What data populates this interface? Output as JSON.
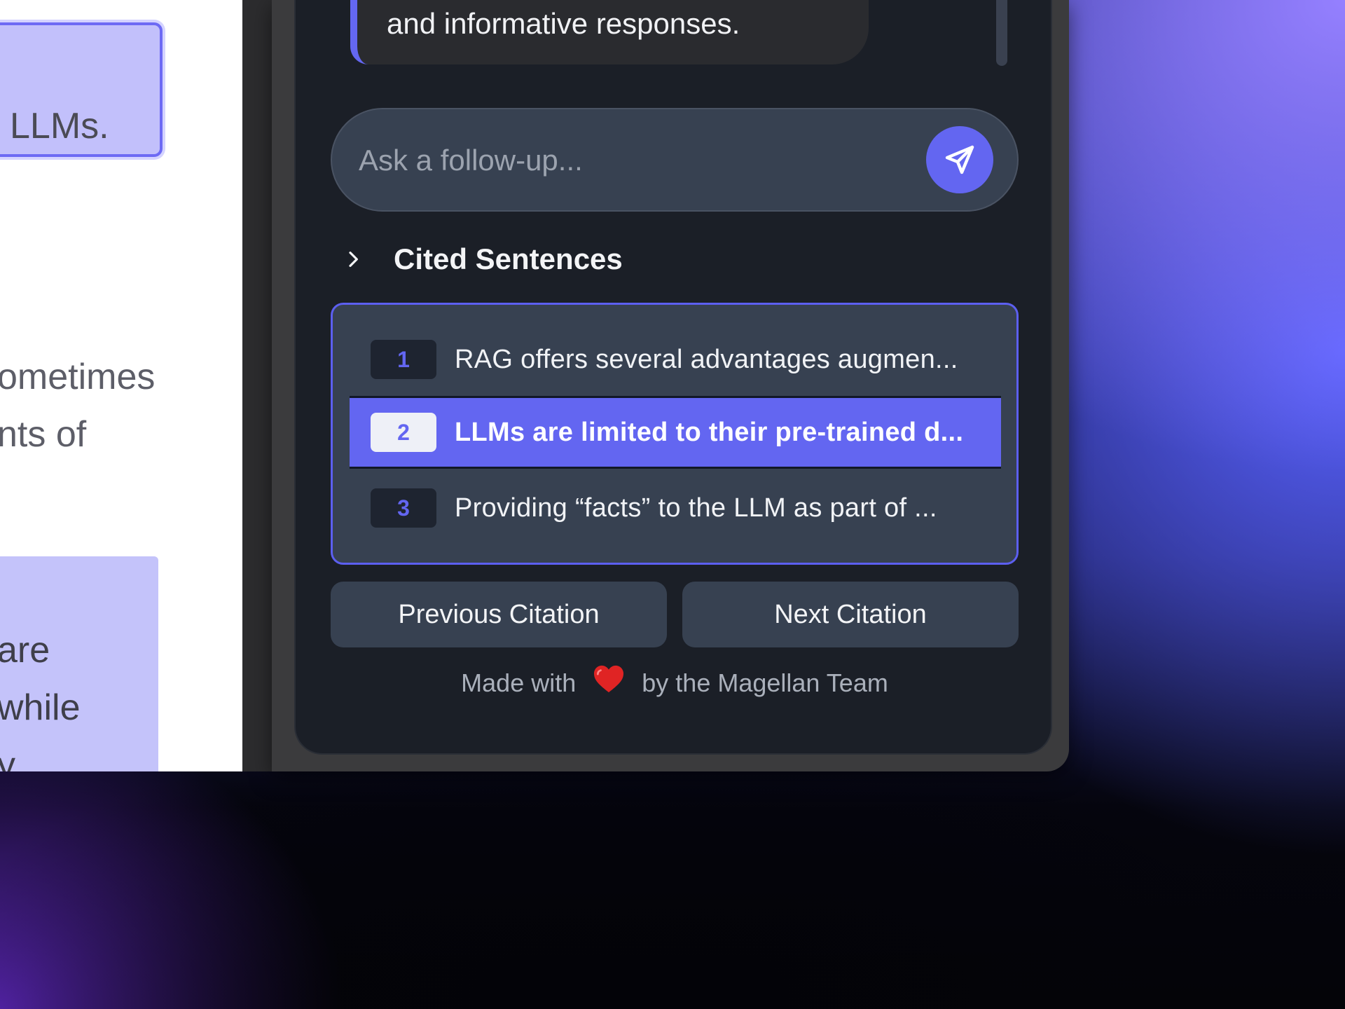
{
  "document": {
    "highlight_top_text": "LLMs.",
    "line_1": "ometimes",
    "line_2": "nts of",
    "highlight_bottom_line_1": "are",
    "highlight_bottom_line_2": "while",
    "highlight_bottom_line_3": "y"
  },
  "chat": {
    "last_message_text": "and informative responses."
  },
  "followup": {
    "placeholder": "Ask a follow-up...",
    "send_icon": "send-icon"
  },
  "cited_sentences": {
    "title": "Cited Sentences",
    "expand_icon": "chevron-right-icon",
    "items": [
      {
        "number": "1",
        "text": "RAG offers several advantages augmen...",
        "active": false
      },
      {
        "number": "2",
        "text": "LLMs are limited to their pre-trained d...",
        "active": true
      },
      {
        "number": "3",
        "text": "Providing “facts” to the LLM as part of ...",
        "active": false
      }
    ]
  },
  "navigation": {
    "previous_label": "Previous Citation",
    "next_label": "Next Citation"
  },
  "footer": {
    "prefix": "Made with",
    "heart_icon": "heart-icon",
    "suffix": "by the Magellan Team"
  },
  "colors": {
    "accent": "#6366f1",
    "panel_bg": "#1b1f27",
    "card_bg": "#374151"
  }
}
